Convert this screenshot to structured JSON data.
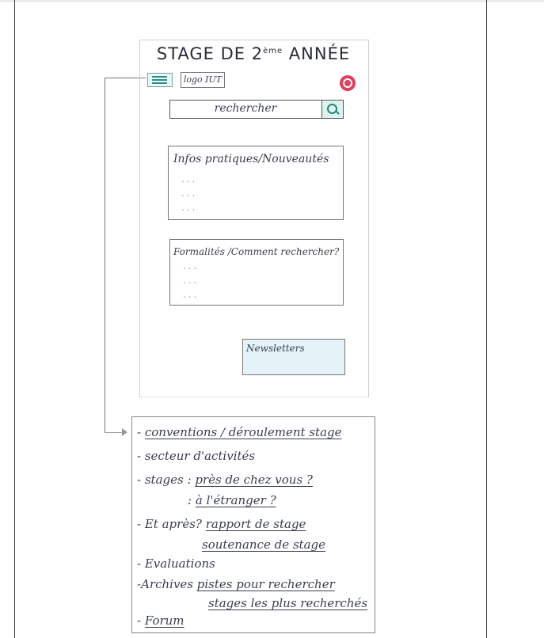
{
  "mockup": {
    "title": "STAGE DE 2",
    "title_sup": "ème",
    "title_tail": " ANNÉE",
    "logo": "logo IUT",
    "search_placeholder": "rechercher",
    "info_block": {
      "label": "Infos pratiques/Nouveautés",
      "dots": [
        "...",
        "...",
        "..."
      ]
    },
    "forms_block": {
      "label": "Formalités /Comment rechercher?",
      "dots": [
        "...",
        "...",
        "..."
      ]
    },
    "newsletter": "Newsletters",
    "icons": {
      "menu": "hamburger-menu-icon",
      "help": "lifebuoy-icon",
      "search": "search-icon"
    },
    "colors": {
      "accent": "#2a8f8c",
      "help": "#e0405a",
      "newsletter_bg": "#e3f3f8"
    }
  },
  "menu": {
    "items": [
      {
        "dash": "-",
        "prefix": "",
        "label": "conventions / déroulement stage"
      },
      {
        "dash": "-",
        "prefix": "",
        "label": "secteur d'activités"
      },
      {
        "dash": "-",
        "prefix": "stages :",
        "label": "près de chez vous ?"
      },
      {
        "dash": "",
        "prefix": ":",
        "label": "à l'étranger ?"
      },
      {
        "dash": "-",
        "prefix": "Et après?",
        "label": "rapport de stage"
      },
      {
        "dash": "",
        "prefix": "",
        "label": "soutenance de stage"
      },
      {
        "dash": "-",
        "prefix": "",
        "label": "Evaluations"
      },
      {
        "dash": "-",
        "prefix": "Archives",
        "label": "pistes pour rechercher"
      },
      {
        "dash": "",
        "prefix": "",
        "label": "stages les plus recherchés"
      },
      {
        "dash": "-",
        "prefix": "",
        "label": "Forum"
      }
    ]
  }
}
